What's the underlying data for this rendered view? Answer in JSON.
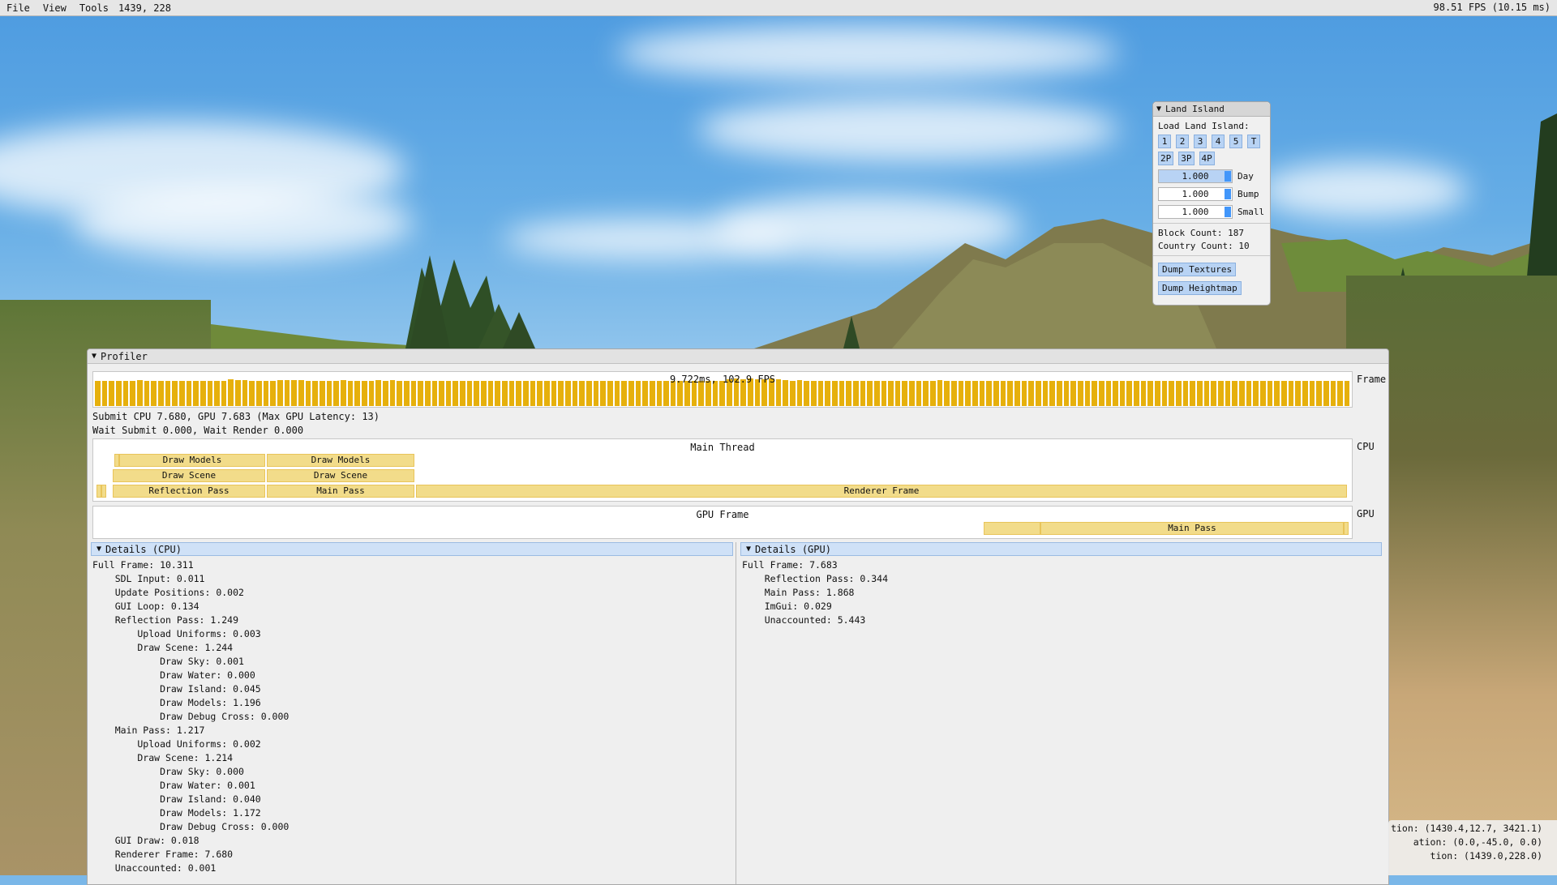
{
  "menubar": {
    "file": "File",
    "view": "View",
    "tools": "Tools",
    "mouse_coords": "1439, 228",
    "fps": "98.51 FPS (10.15 ms)"
  },
  "land_island": {
    "title": "Land Island",
    "load_label": "Load Land Island:",
    "island_buttons": [
      "1",
      "2",
      "3",
      "4",
      "5",
      "T"
    ],
    "pack_buttons": [
      "2P",
      "3P",
      "4P"
    ],
    "sliders": [
      {
        "value": "1.000",
        "label": "Day"
      },
      {
        "value": "1.000",
        "label": "Bump"
      },
      {
        "value": "1.000",
        "label": "Small"
      }
    ],
    "block_count": "Block Count: 187",
    "country_count": "Country Count: 10",
    "dump_textures": "Dump Textures",
    "dump_heightmap": "Dump Heightmap"
  },
  "profiler": {
    "title": "Profiler",
    "histogram_label": "9.722ms, 102.9 FPS",
    "histogram_values": [
      0.62,
      0.62,
      0.62,
      0.62,
      0.63,
      0.62,
      0.64,
      0.62,
      0.63,
      0.62,
      0.62,
      0.62,
      0.63,
      0.62,
      0.62,
      0.62,
      0.62,
      0.62,
      0.62,
      0.66,
      0.64,
      0.64,
      0.62,
      0.62,
      0.62,
      0.63,
      0.64,
      0.64,
      0.64,
      0.64,
      0.63,
      0.62,
      0.62,
      0.62,
      0.62,
      0.64,
      0.62,
      0.62,
      0.62,
      0.62,
      0.64,
      0.62,
      0.64,
      0.62,
      0.62,
      0.62,
      0.62,
      0.63,
      0.62,
      0.62,
      0.62,
      0.63,
      0.62,
      0.62,
      0.62,
      0.62,
      0.62,
      0.62,
      0.62,
      0.62,
      0.62,
      0.62,
      0.62,
      0.62,
      0.62,
      0.62,
      0.62,
      0.62,
      0.62,
      0.62,
      0.62,
      0.62,
      0.62,
      0.62,
      0.62,
      0.62,
      0.62,
      0.62,
      0.62,
      0.62,
      0.62,
      0.62,
      0.62,
      0.62,
      0.62,
      0.62,
      0.62,
      0.62,
      0.62,
      0.62,
      0.66,
      0.68,
      0.66,
      0.68,
      0.66,
      0.66,
      0.68,
      0.66,
      0.64,
      0.62,
      0.64,
      0.62,
      0.62,
      0.62,
      0.62,
      0.62,
      0.62,
      0.62,
      0.62,
      0.62,
      0.62,
      0.62,
      0.62,
      0.62,
      0.62,
      0.62,
      0.62,
      0.62,
      0.62,
      0.63,
      0.64,
      0.62,
      0.62,
      0.62,
      0.62,
      0.62,
      0.62,
      0.62,
      0.62,
      0.62,
      0.62,
      0.62,
      0.62,
      0.62,
      0.62,
      0.62,
      0.62,
      0.62,
      0.62,
      0.62,
      0.62,
      0.62,
      0.62,
      0.62,
      0.62,
      0.62,
      0.62,
      0.62,
      0.62,
      0.62,
      0.62,
      0.62,
      0.62,
      0.62,
      0.62,
      0.62,
      0.62,
      0.62,
      0.62,
      0.62,
      0.62,
      0.62,
      0.62,
      0.62,
      0.62,
      0.62,
      0.62,
      0.62,
      0.62,
      0.62,
      0.62,
      0.62,
      0.62,
      0.62,
      0.62,
      0.62,
      0.62,
      0.62,
      0.62
    ],
    "frame_label": "Frame",
    "submit_line": "Submit CPU 7.680, GPU 7.683 (Max GPU Latency: 13)",
    "wait_line": "Wait Submit 0.000, Wait Render 0.000",
    "cpu_label": "CPU",
    "gpu_label": "GPU",
    "main_thread": "Main Thread",
    "gpu_frame": "GPU Frame",
    "cpu_blocks": {
      "draw_models_1": "Draw Models",
      "draw_models_2": "Draw Models",
      "draw_scene_1": "Draw Scene",
      "draw_scene_2": "Draw Scene",
      "reflection_pass": "Reflection Pass",
      "main_pass": "Main Pass",
      "renderer_frame": "Renderer Frame"
    },
    "gpu_blocks": {
      "main_pass": "Main Pass"
    },
    "details_cpu": {
      "title": "Details (CPU)",
      "lines": [
        "Full Frame: 10.311",
        "    SDL Input: 0.011",
        "    Update Positions: 0.002",
        "    GUI Loop: 0.134",
        "    Reflection Pass: 1.249",
        "        Upload Uniforms: 0.003",
        "        Draw Scene: 1.244",
        "            Draw Sky: 0.001",
        "            Draw Water: 0.000",
        "            Draw Island: 0.045",
        "            Draw Models: 1.196",
        "            Draw Debug Cross: 0.000",
        "    Main Pass: 1.217",
        "        Upload Uniforms: 0.002",
        "        Draw Scene: 1.214",
        "            Draw Sky: 0.000",
        "            Draw Water: 0.001",
        "            Draw Island: 0.040",
        "            Draw Models: 1.172",
        "            Draw Debug Cross: 0.000",
        "    GUI Draw: 0.018",
        "    Renderer Frame: 7.680",
        "    Unaccounted: 0.001"
      ]
    },
    "details_gpu": {
      "title": "Details (GPU)",
      "lines": [
        "Full Frame: 7.683",
        "    Reflection Pass: 0.344",
        "    Main Pass: 1.868",
        "    ImGui: 0.029",
        "    Unaccounted: 5.443"
      ]
    }
  },
  "camera_overlay": {
    "lines": [
      "tion: (1430.4,12.7, 3421.1)",
      "ation: (0.0,-45.0, 0.0)",
      "tion: (1439.0,228.0)"
    ]
  },
  "colors": {
    "histogram_bar": "#e6b00c",
    "profile_block": "#f2dc8a",
    "button_blue": "#b8d3f4",
    "slider_grab": "#4296fa"
  }
}
